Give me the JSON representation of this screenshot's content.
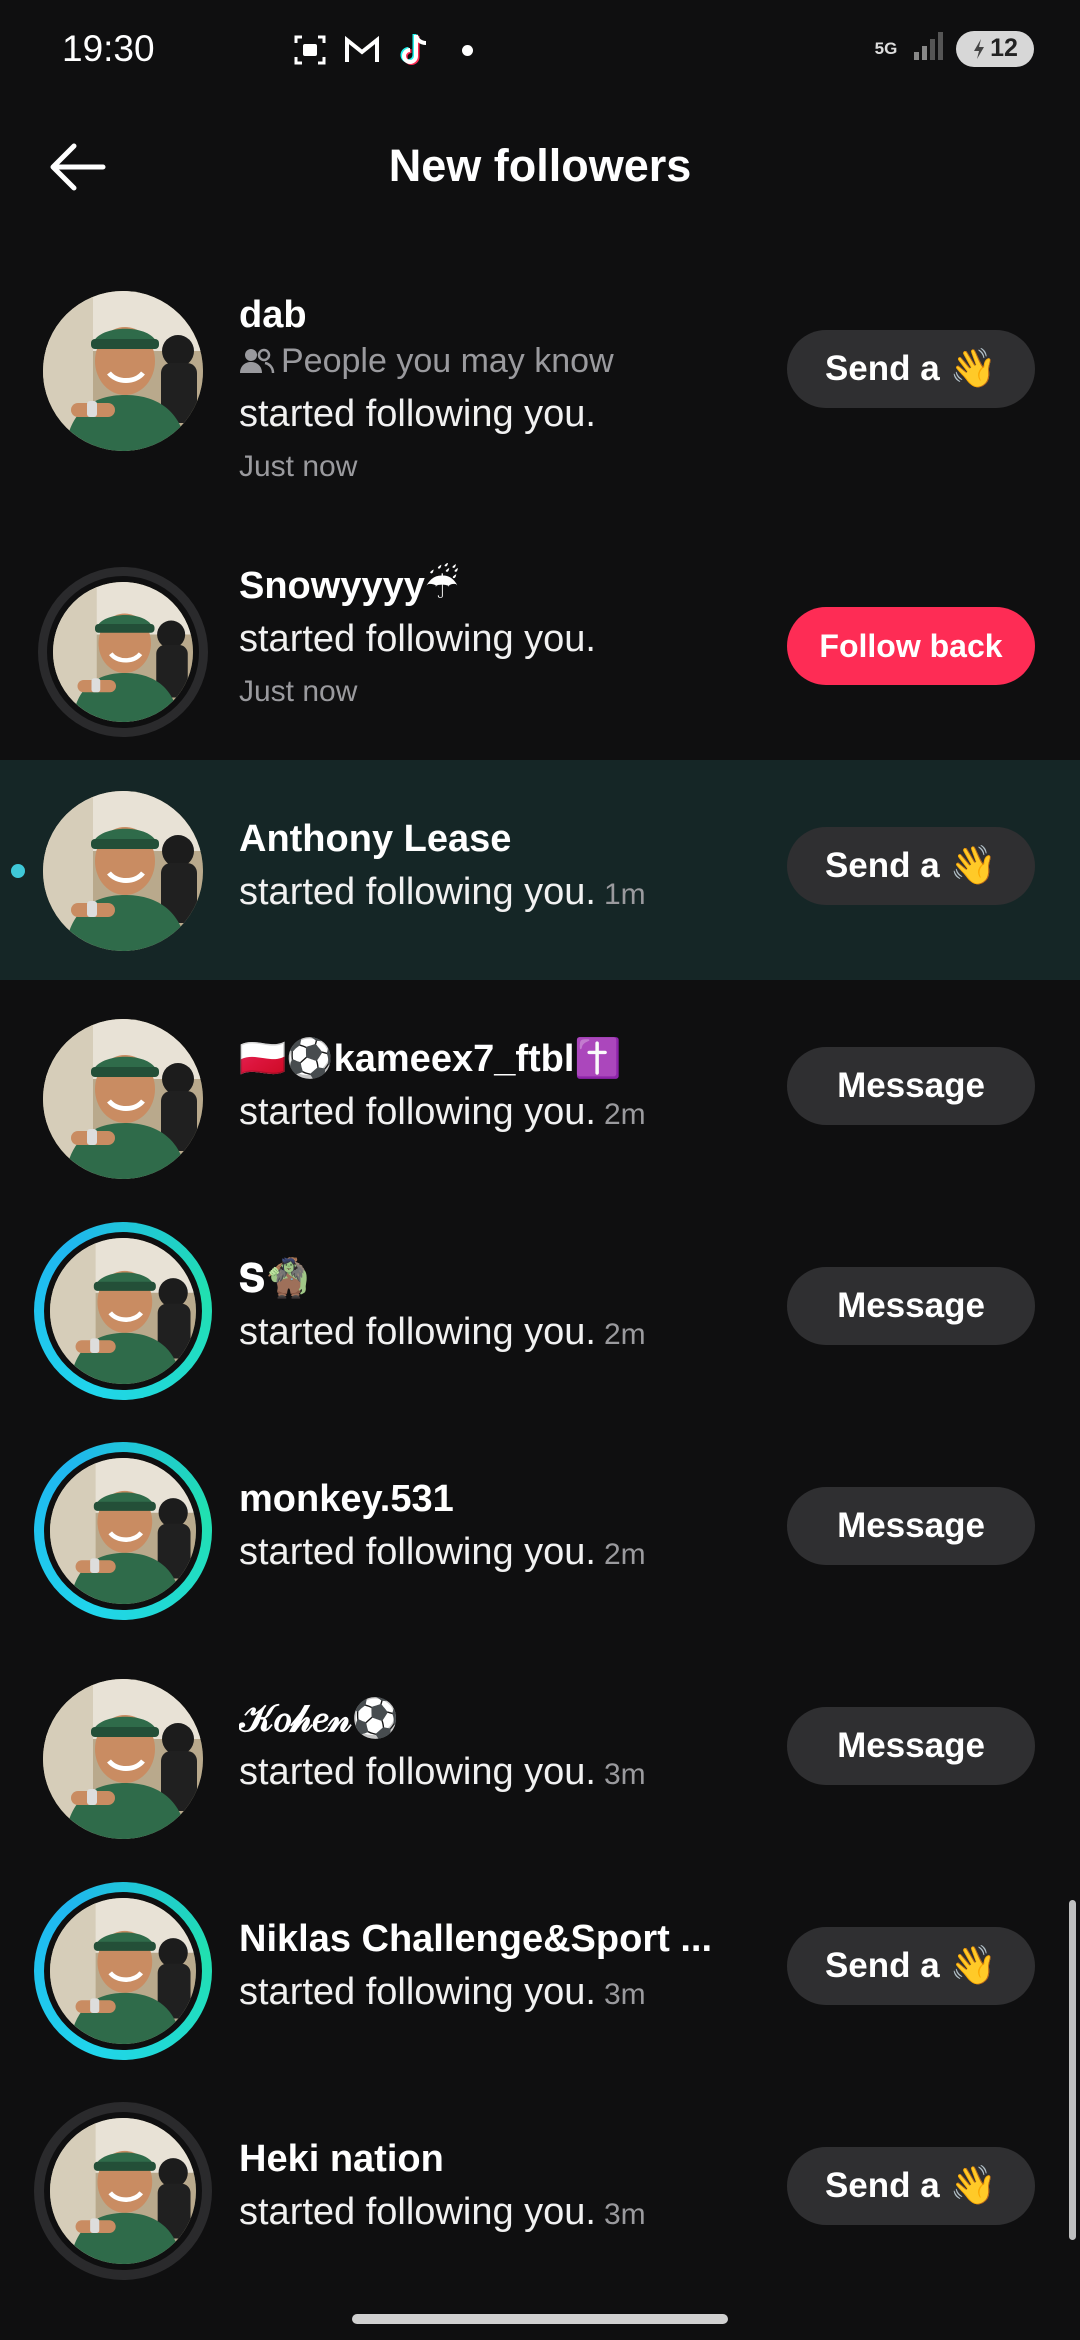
{
  "status_bar": {
    "time": "19:30",
    "network": "5G",
    "battery": "12",
    "icons_left": [
      "screenshot-icon",
      "gmail-icon",
      "tiktok-icon",
      "notification-dot"
    ],
    "icons_right": [
      "5g-icon",
      "signal-icon",
      "battery-icon"
    ]
  },
  "header": {
    "title": "New followers",
    "back_icon": "arrow-left-icon"
  },
  "followers": [
    {
      "name": "dab",
      "sub": "People you may know",
      "action": "started following you.",
      "time": "Just now",
      "button": "Send a",
      "button_type": "send"
    },
    {
      "name": "Snowyyyy☔",
      "action": "started following you.",
      "time": "Just now",
      "button": "Follow back",
      "button_type": "follow"
    },
    {
      "name": "Anthony Lease",
      "action": "started following you.",
      "time": "1m",
      "button": "Send a",
      "button_type": "send",
      "unread": true
    },
    {
      "name": "🇵🇱⚽kameex7_ftbl✝️",
      "action": "started following you.",
      "time": "2m",
      "button": "Message",
      "button_type": "message"
    },
    {
      "name": "  𝐒🧌",
      "action": "started following you.",
      "time": "2m",
      "button": "Message",
      "button_type": "message"
    },
    {
      "name": "monkey.531",
      "action": "started following you.",
      "time": "2m",
      "button": "Message",
      "button_type": "message"
    },
    {
      "name": "𝒦𝑜𝒽𝑒𝓃⚽",
      "action": "started following you.",
      "time": "3m",
      "button": "Message",
      "button_type": "message"
    },
    {
      "name": "Niklas Challenge&Sport ...",
      "action": "started following you.",
      "time": "3m",
      "button": "Send a",
      "button_type": "send"
    },
    {
      "name": "Heki nation",
      "action": "started following you.",
      "time": "3m",
      "button": "Send a",
      "button_type": "send"
    }
  ],
  "wave_emoji": "👋",
  "colors": {
    "background": "#0f0f10",
    "highlight_row": "#152626",
    "follow_back": "#fe2c55",
    "button": "#2f2f31",
    "story_ring": "#20d5ec"
  }
}
